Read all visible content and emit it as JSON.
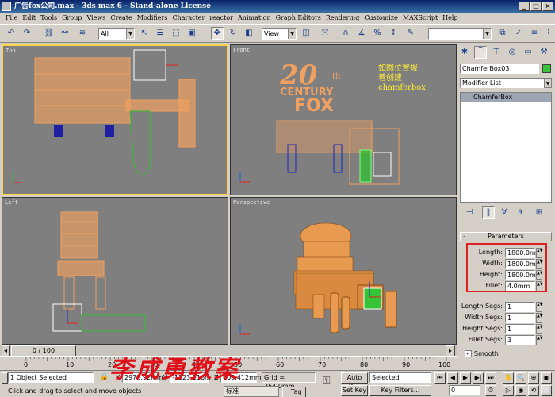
{
  "window": {
    "title": "广告fox公司.max - 3ds max 6 - Stand-alone License",
    "buttons": {
      "minimize": "_",
      "maximize": "□",
      "close": "×"
    }
  },
  "menu": [
    "File",
    "Edit",
    "Tools",
    "Group",
    "Views",
    "Create",
    "Modifiers",
    "Character",
    "reactor",
    "Animation",
    "Graph Editors",
    "Rendering",
    "Customize",
    "MAXScript",
    "Help"
  ],
  "toolbar": {
    "selection_filter": "All",
    "reference_coord": "View",
    "named_selection": ""
  },
  "viewports": {
    "top": "Top",
    "front": "Front",
    "left": "Left",
    "perspective": "Perspective"
  },
  "annotation": {
    "line1": "如图位置拨",
    "line2": "着创建",
    "line3": "chamferbox"
  },
  "logo_text": {
    "big": "20",
    "small": "th",
    "century": "CENTURY",
    "fox": "FOX"
  },
  "command_panel": {
    "object_name": "ChamferBox03",
    "object_color": "#39c439",
    "modifier_list": "Modifier List",
    "stack_item": "ChamferBox",
    "rollout_title": "Parameters",
    "params": [
      {
        "label": "Length:",
        "value": "1800.0mm"
      },
      {
        "label": "Width:",
        "value": "1800.0mm"
      },
      {
        "label": "Height:",
        "value": "1800.0mm"
      },
      {
        "label": "Fillet:",
        "value": "4.0mm"
      }
    ],
    "segs": [
      {
        "label": "Length Segs:",
        "value": "1"
      },
      {
        "label": "Width Segs:",
        "value": "1"
      },
      {
        "label": "Height Segs:",
        "value": "1"
      },
      {
        "label": "Fillet Segs:",
        "value": "3"
      }
    ],
    "smooth_label": "Smooth"
  },
  "timeline": {
    "frame": "0 / 100",
    "ticks": [
      "0",
      "10",
      "20",
      "30",
      "40",
      "50",
      "60",
      "70",
      "80",
      "90",
      "100"
    ]
  },
  "status": {
    "selection": "1 Object Selected",
    "prompt": "Click and drag to select and move objects",
    "x_value": "2972.92mm",
    "y_value": "-1223.116m",
    "z_value": "608.412mm",
    "grid": "Grid = 254.0mm",
    "auto_key": "Auto Key",
    "set_key": "Set Key",
    "key_mode": "Selected",
    "key_filters": "Key Filters...",
    "current_frame": "0",
    "tag": "Tag",
    "ime": "标准"
  },
  "watermark": "李成勇教案",
  "colors": {
    "viewport_bg": "#7f7f7f",
    "object_orange": "#f0a060",
    "highlight_red": "#e02020",
    "annotation_yellow": "#ffee33"
  }
}
